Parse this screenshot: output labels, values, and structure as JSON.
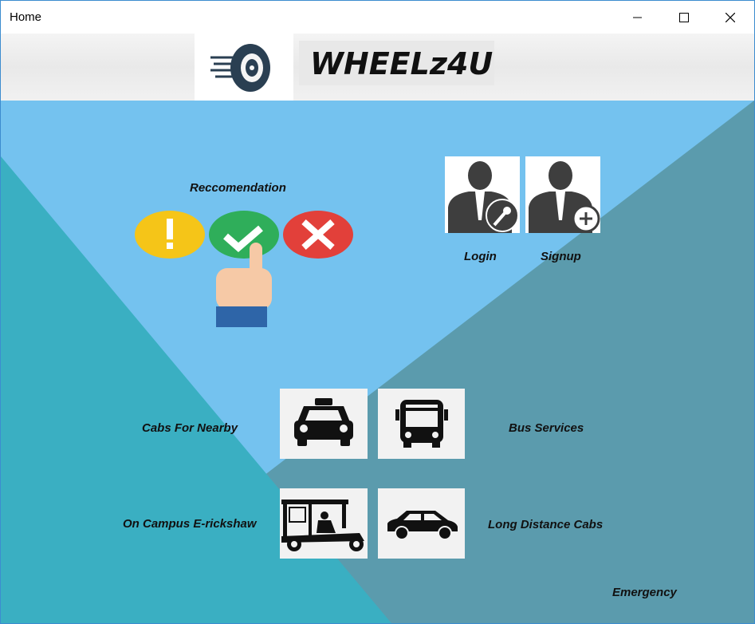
{
  "window": {
    "title": "Home"
  },
  "banner": {
    "brand": "WHEELz4U"
  },
  "recommendation": {
    "label": "Reccomendation"
  },
  "account": {
    "login_label": "Login",
    "signup_label": "Signup"
  },
  "services": {
    "cabs_nearby": "Cabs For Nearby",
    "bus": "Bus Services",
    "erickshaw": "On Campus E-rickshaw",
    "long_distance": "Long Distance Cabs"
  },
  "emergency": {
    "label": "Emergency"
  },
  "colors": {
    "sky": "#74c2ef",
    "teal": "#3aafc2",
    "steel": "#5b9bad"
  }
}
